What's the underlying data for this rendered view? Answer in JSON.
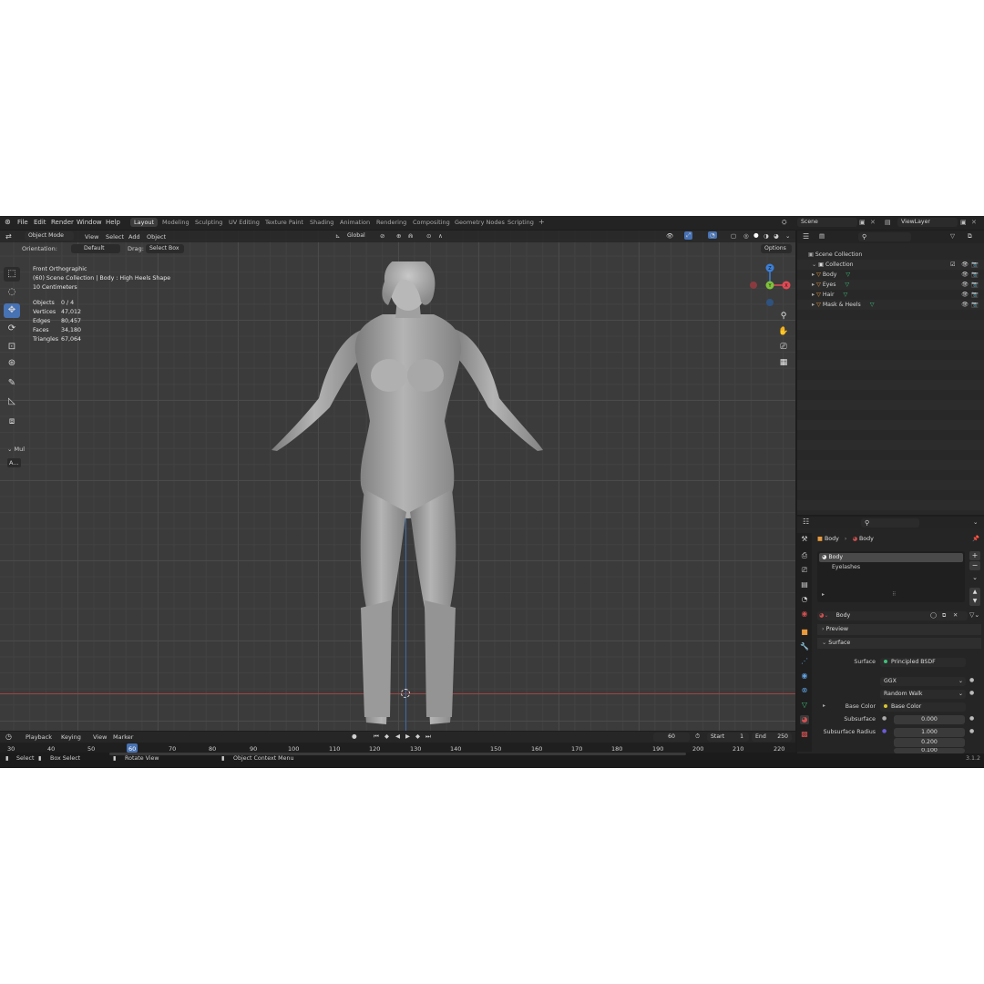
{
  "topbar": {
    "menus": [
      "File",
      "Edit",
      "Render",
      "Window",
      "Help"
    ],
    "workspaces": [
      "Layout",
      "Modeling",
      "Sculpting",
      "UV Editing",
      "Texture Paint",
      "Shading",
      "Animation",
      "Rendering",
      "Compositing",
      "Geometry Nodes",
      "Scripting"
    ],
    "add_tab": "+",
    "scene": "Scene",
    "view_layer": "ViewLayer"
  },
  "viewport": {
    "mode": "Object Mode",
    "menus": [
      "View",
      "Select",
      "Add",
      "Object"
    ],
    "transform_orientation": "Global",
    "orientation_label": "Orientation:",
    "orientation_value": "Default",
    "drag_label": "Drag:",
    "drag_value": "Select Box",
    "options_label": "Options",
    "info": {
      "view": "Front Orthographic",
      "collection": "(60) Scene Collection | Body : High Heels Shape",
      "scale": "10 Centimeters",
      "stats": [
        {
          "label": "Objects",
          "value": "0 / 4"
        },
        {
          "label": "Vertices",
          "value": "47,012"
        },
        {
          "label": "Edges",
          "value": "80,457"
        },
        {
          "label": "Faces",
          "value": "34,180"
        },
        {
          "label": "Triangles",
          "value": "67,064"
        }
      ]
    },
    "gizmo_axes": {
      "x": "X",
      "y": "Y",
      "z": "Z"
    },
    "operator_panel": "Mul",
    "operator_panel_short": "A..."
  },
  "timeline": {
    "menus": [
      "Playback",
      "Keying",
      "View",
      "Marker"
    ],
    "current_frame": "60",
    "start_label": "Start",
    "start_value": "1",
    "end_label": "End",
    "end_value": "250",
    "ticks": [
      "30",
      "40",
      "50",
      "60",
      "70",
      "80",
      "90",
      "100",
      "110",
      "120",
      "130",
      "140",
      "150",
      "160",
      "170",
      "180",
      "190",
      "200",
      "210",
      "220"
    ]
  },
  "statusbar": {
    "select": "Select",
    "box_select": "Box Select",
    "rotate_view": "Rotate View",
    "context_menu": "Object Context Menu",
    "version": "3.1.2"
  },
  "outliner": {
    "root": "Scene Collection",
    "collection": "Collection",
    "items": [
      "Body",
      "Eyes",
      "Hair",
      "Mask & Heels"
    ]
  },
  "properties": {
    "breadcrumb_object": "Body",
    "breadcrumb_material": "Body",
    "material_slots": [
      "Body",
      "Eyelashes"
    ],
    "material_name": "Body",
    "panels": {
      "preview": "Preview",
      "surface": "Surface"
    },
    "surface_label": "Surface",
    "surface_value": "Principled BSDF",
    "distribution": "GGX",
    "subsurface_method": "Random Walk",
    "base_color_label": "Base Color",
    "base_color_value": "Base Color",
    "subsurface_label": "Subsurface",
    "subsurface_value": "0.000",
    "subsurface_radius_label": "Subsurface Radius",
    "subsurface_radius_values": [
      "1.000",
      "0.200",
      "0.100"
    ]
  },
  "colors": {
    "accent_blue": "#4772b3",
    "axis_x": "#e04a54",
    "axis_y": "#7ec23a",
    "axis_z": "#3c7fd6",
    "object_orange": "#e89a3c",
    "mesh_green": "#3fbf7c"
  }
}
